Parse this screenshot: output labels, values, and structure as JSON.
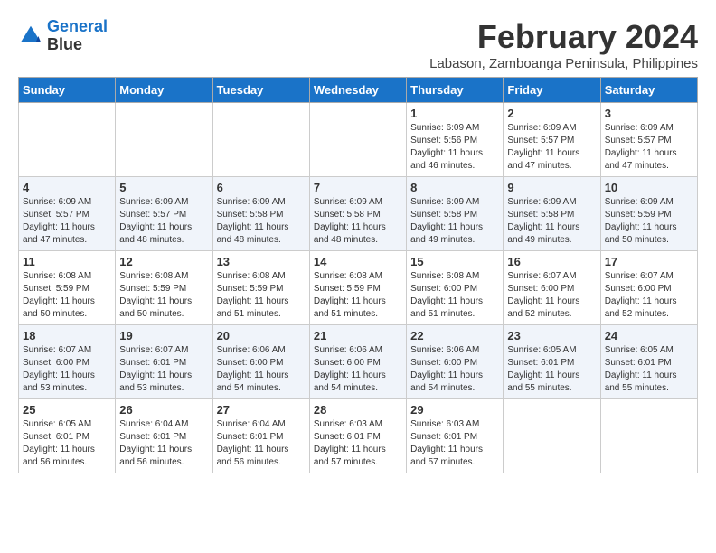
{
  "header": {
    "logo_line1": "General",
    "logo_line2": "Blue",
    "month_title": "February 2024",
    "subtitle": "Labason, Zamboanga Peninsula, Philippines"
  },
  "weekdays": [
    "Sunday",
    "Monday",
    "Tuesday",
    "Wednesday",
    "Thursday",
    "Friday",
    "Saturday"
  ],
  "weeks": [
    [
      {
        "day": "",
        "info": ""
      },
      {
        "day": "",
        "info": ""
      },
      {
        "day": "",
        "info": ""
      },
      {
        "day": "",
        "info": ""
      },
      {
        "day": "1",
        "sunrise": "6:09 AM",
        "sunset": "5:56 PM",
        "daylight": "11 hours and 46 minutes."
      },
      {
        "day": "2",
        "sunrise": "6:09 AM",
        "sunset": "5:57 PM",
        "daylight": "11 hours and 47 minutes."
      },
      {
        "day": "3",
        "sunrise": "6:09 AM",
        "sunset": "5:57 PM",
        "daylight": "11 hours and 47 minutes."
      }
    ],
    [
      {
        "day": "4",
        "sunrise": "6:09 AM",
        "sunset": "5:57 PM",
        "daylight": "11 hours and 47 minutes."
      },
      {
        "day": "5",
        "sunrise": "6:09 AM",
        "sunset": "5:57 PM",
        "daylight": "11 hours and 48 minutes."
      },
      {
        "day": "6",
        "sunrise": "6:09 AM",
        "sunset": "5:58 PM",
        "daylight": "11 hours and 48 minutes."
      },
      {
        "day": "7",
        "sunrise": "6:09 AM",
        "sunset": "5:58 PM",
        "daylight": "11 hours and 48 minutes."
      },
      {
        "day": "8",
        "sunrise": "6:09 AM",
        "sunset": "5:58 PM",
        "daylight": "11 hours and 49 minutes."
      },
      {
        "day": "9",
        "sunrise": "6:09 AM",
        "sunset": "5:58 PM",
        "daylight": "11 hours and 49 minutes."
      },
      {
        "day": "10",
        "sunrise": "6:09 AM",
        "sunset": "5:59 PM",
        "daylight": "11 hours and 50 minutes."
      }
    ],
    [
      {
        "day": "11",
        "sunrise": "6:08 AM",
        "sunset": "5:59 PM",
        "daylight": "11 hours and 50 minutes."
      },
      {
        "day": "12",
        "sunrise": "6:08 AM",
        "sunset": "5:59 PM",
        "daylight": "11 hours and 50 minutes."
      },
      {
        "day": "13",
        "sunrise": "6:08 AM",
        "sunset": "5:59 PM",
        "daylight": "11 hours and 51 minutes."
      },
      {
        "day": "14",
        "sunrise": "6:08 AM",
        "sunset": "5:59 PM",
        "daylight": "11 hours and 51 minutes."
      },
      {
        "day": "15",
        "sunrise": "6:08 AM",
        "sunset": "6:00 PM",
        "daylight": "11 hours and 51 minutes."
      },
      {
        "day": "16",
        "sunrise": "6:07 AM",
        "sunset": "6:00 PM",
        "daylight": "11 hours and 52 minutes."
      },
      {
        "day": "17",
        "sunrise": "6:07 AM",
        "sunset": "6:00 PM",
        "daylight": "11 hours and 52 minutes."
      }
    ],
    [
      {
        "day": "18",
        "sunrise": "6:07 AM",
        "sunset": "6:00 PM",
        "daylight": "11 hours and 53 minutes."
      },
      {
        "day": "19",
        "sunrise": "6:07 AM",
        "sunset": "6:01 PM",
        "daylight": "11 hours and 53 minutes."
      },
      {
        "day": "20",
        "sunrise": "6:06 AM",
        "sunset": "6:00 PM",
        "daylight": "11 hours and 54 minutes."
      },
      {
        "day": "21",
        "sunrise": "6:06 AM",
        "sunset": "6:00 PM",
        "daylight": "11 hours and 54 minutes."
      },
      {
        "day": "22",
        "sunrise": "6:06 AM",
        "sunset": "6:00 PM",
        "daylight": "11 hours and 54 minutes."
      },
      {
        "day": "23",
        "sunrise": "6:05 AM",
        "sunset": "6:01 PM",
        "daylight": "11 hours and 55 minutes."
      },
      {
        "day": "24",
        "sunrise": "6:05 AM",
        "sunset": "6:01 PM",
        "daylight": "11 hours and 55 minutes."
      }
    ],
    [
      {
        "day": "25",
        "sunrise": "6:05 AM",
        "sunset": "6:01 PM",
        "daylight": "11 hours and 56 minutes."
      },
      {
        "day": "26",
        "sunrise": "6:04 AM",
        "sunset": "6:01 PM",
        "daylight": "11 hours and 56 minutes."
      },
      {
        "day": "27",
        "sunrise": "6:04 AM",
        "sunset": "6:01 PM",
        "daylight": "11 hours and 56 minutes."
      },
      {
        "day": "28",
        "sunrise": "6:03 AM",
        "sunset": "6:01 PM",
        "daylight": "11 hours and 57 minutes."
      },
      {
        "day": "29",
        "sunrise": "6:03 AM",
        "sunset": "6:01 PM",
        "daylight": "11 hours and 57 minutes."
      },
      {
        "day": "",
        "info": ""
      },
      {
        "day": "",
        "info": ""
      }
    ]
  ]
}
